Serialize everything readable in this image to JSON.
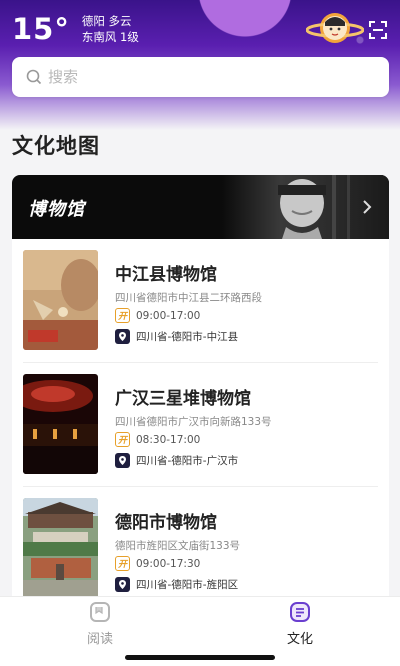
{
  "weather": {
    "temperature": "15°",
    "city_condition": "德阳 多云",
    "wind": "东南风 1级"
  },
  "search": {
    "placeholder": "搜索"
  },
  "section": {
    "title": "文化地图"
  },
  "category": {
    "title": "博物馆"
  },
  "museums": [
    {
      "name": "中江县博物馆",
      "address": "四川省德阳市中江县二环路西段",
      "hours_badge": "开",
      "hours": "09:00-17:00",
      "region": "四川省-德阳市-中江县"
    },
    {
      "name": "广汉三星堆博物馆",
      "address": "四川省德阳市广汉市向新路133号",
      "hours_badge": "开",
      "hours": "08:30-17:00",
      "region": "四川省-德阳市-广汉市"
    },
    {
      "name": "德阳市博物馆",
      "address": "德阳市旌阳区文庙街133号",
      "hours_badge": "开",
      "hours": "09:00-17:30",
      "region": "四川省-德阳市-旌阳区"
    }
  ],
  "tabbar": {
    "tabs": [
      {
        "label": "阅读",
        "icon": "book-icon",
        "active": false
      },
      {
        "label": "文化",
        "icon": "culture-icon",
        "active": true
      }
    ]
  },
  "colors": {
    "accent": "#6a3fcf",
    "open_badge": "#e7a02a",
    "inactive_tab": "#999999"
  }
}
